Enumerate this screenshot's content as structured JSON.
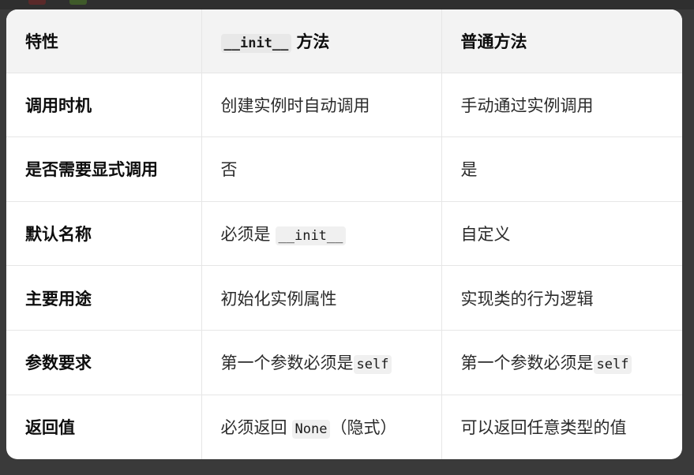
{
  "table": {
    "headers": {
      "feature": "特性",
      "init_code": "__init__",
      "init_suffix": "方法",
      "normal": "普通方法"
    },
    "rows": [
      {
        "feature": "调用时机",
        "init_text": "创建实例时自动调用",
        "normal_text": "手动通过实例调用"
      },
      {
        "feature": "是否需要显式调用",
        "init_text": "否",
        "normal_text": "是"
      },
      {
        "feature": "默认名称",
        "init_text": "必须是",
        "init_code": "__init__",
        "normal_text": "自定义"
      },
      {
        "feature": "主要用途",
        "init_text": "初始化实例属性",
        "normal_text": "实现类的行为逻辑"
      },
      {
        "feature": "参数要求",
        "init_text": "第一个参数必须是",
        "init_code": "self",
        "normal_text": "第一个参数必须是",
        "normal_code": "self"
      },
      {
        "feature": "返回值",
        "init_text": "必须返回",
        "init_code": "None",
        "init_suffix": "（隐式）",
        "normal_text": "可以返回任意类型的值"
      }
    ]
  }
}
